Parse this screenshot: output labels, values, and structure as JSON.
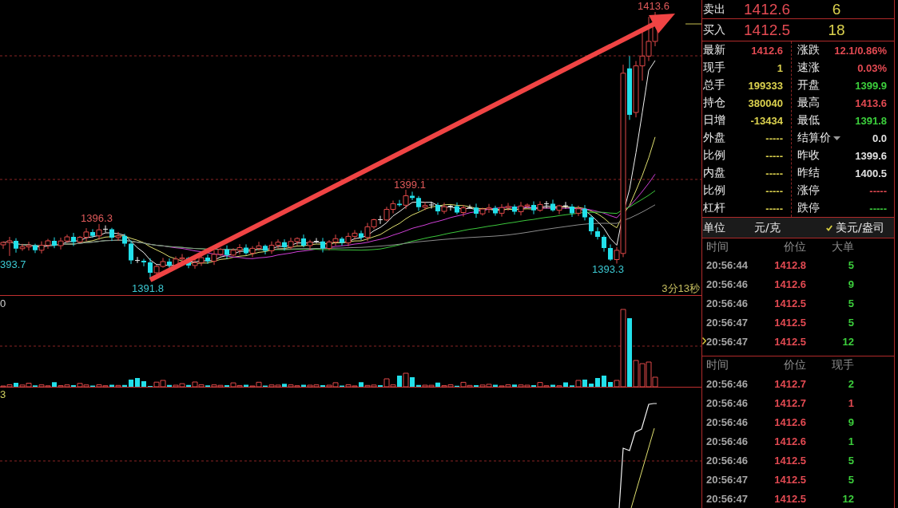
{
  "chart": {
    "price_labels": [
      {
        "text": "1413.6",
        "kind": "high"
      },
      {
        "text": "1399.1",
        "kind": "high"
      },
      {
        "text": "1396.3",
        "kind": "high"
      },
      {
        "text": "393.7",
        "kind": "low"
      },
      {
        "text": "1391.8",
        "kind": "low"
      },
      {
        "text": "1393.3",
        "kind": "low"
      }
    ],
    "countdown": "3分13秒",
    "volume_pane_label": "0",
    "indicator_pane_label": "3"
  },
  "quote": {
    "ask": {
      "label": "卖出",
      "price": "1412.6",
      "volume": "6"
    },
    "bid": {
      "label": "买入",
      "price": "1412.5",
      "volume": "18"
    },
    "stats_left": [
      {
        "label": "最新",
        "value": "1412.6",
        "color": "#e34a52"
      },
      {
        "label": "现手",
        "value": "1",
        "color": "#dcd24e"
      },
      {
        "label": "总手",
        "value": "199333",
        "color": "#dcd24e"
      },
      {
        "label": "持仓",
        "value": "380040",
        "color": "#dcd24e"
      },
      {
        "label": "日增",
        "value": "-13434",
        "color": "#dcd24e"
      },
      {
        "label": "外盘",
        "value": "-----",
        "color": "#dcd24e"
      },
      {
        "label": "比例",
        "value": "-----",
        "color": "#dcd24e"
      },
      {
        "label": "内盘",
        "value": "-----",
        "color": "#dcd24e"
      },
      {
        "label": "比例",
        "value": "-----",
        "color": "#dcd24e"
      },
      {
        "label": "杠杆",
        "value": "-----",
        "color": "#dcd24e"
      }
    ],
    "stats_right": [
      {
        "label": "涨跌",
        "value": "12.1/0.86%",
        "color": "#e34a52",
        "kind": "plain"
      },
      {
        "label": "速涨",
        "value": "0.03%",
        "color": "#e34a52",
        "kind": "plain"
      },
      {
        "label": "开盘",
        "value": "1399.9",
        "color": "#3ccf3c",
        "kind": "plain"
      },
      {
        "label": "最高",
        "value": "1413.6",
        "color": "#e34a52",
        "kind": "plain"
      },
      {
        "label": "最低",
        "value": "1391.8",
        "color": "#3ccf3c",
        "kind": "plain"
      },
      {
        "label": "结算价",
        "value": "0.0",
        "color": "#e0e0e0",
        "kind": "menu"
      },
      {
        "label": "昨收",
        "value": "1399.6",
        "color": "#e0e0e0",
        "kind": "plain"
      },
      {
        "label": "昨结",
        "value": "1400.5",
        "color": "#e0e0e0",
        "kind": "plain"
      },
      {
        "label": "涨停",
        "value": "-----",
        "color": "#e34a52",
        "kind": "plain"
      },
      {
        "label": "跌停",
        "value": "-----",
        "color": "#3ccf3c",
        "kind": "plain"
      }
    ],
    "unit": {
      "label": "单位",
      "options": [
        {
          "label": "元/克",
          "selected": false
        },
        {
          "label": "美元/盎司",
          "selected": true
        }
      ]
    }
  },
  "big_trades": {
    "columns": [
      "时间",
      "价位",
      "大单"
    ],
    "rows": [
      {
        "time": "20:56:44",
        "price": "1412.8",
        "volume": "5",
        "color": "#3ccf3c",
        "selected": false
      },
      {
        "time": "20:56:46",
        "price": "1412.6",
        "volume": "9",
        "color": "#3ccf3c",
        "selected": false
      },
      {
        "time": "20:56:46",
        "price": "1412.5",
        "volume": "5",
        "color": "#3ccf3c",
        "selected": false
      },
      {
        "time": "20:56:47",
        "price": "1412.5",
        "volume": "5",
        "color": "#3ccf3c",
        "selected": false
      },
      {
        "time": "20:56:47",
        "price": "1412.5",
        "volume": "12",
        "color": "#3ccf3c",
        "selected": true
      }
    ]
  },
  "ticks": {
    "columns": [
      "时间",
      "价位",
      "现手"
    ],
    "rows": [
      {
        "time": "20:56:46",
        "price": "1412.7",
        "volume": "2",
        "color": "#3ccf3c"
      },
      {
        "time": "20:56:46",
        "price": "1412.7",
        "volume": "1",
        "color": "#e34a52"
      },
      {
        "time": "20:56:46",
        "price": "1412.6",
        "volume": "9",
        "color": "#3ccf3c"
      },
      {
        "time": "20:56:46",
        "price": "1412.6",
        "volume": "1",
        "color": "#3ccf3c"
      },
      {
        "time": "20:56:46",
        "price": "1412.5",
        "volume": "5",
        "color": "#3ccf3c"
      },
      {
        "time": "20:56:47",
        "price": "1412.5",
        "volume": "5",
        "color": "#3ccf3c"
      },
      {
        "time": "20:56:47",
        "price": "1412.5",
        "volume": "12",
        "color": "#3ccf3c"
      }
    ]
  }
}
